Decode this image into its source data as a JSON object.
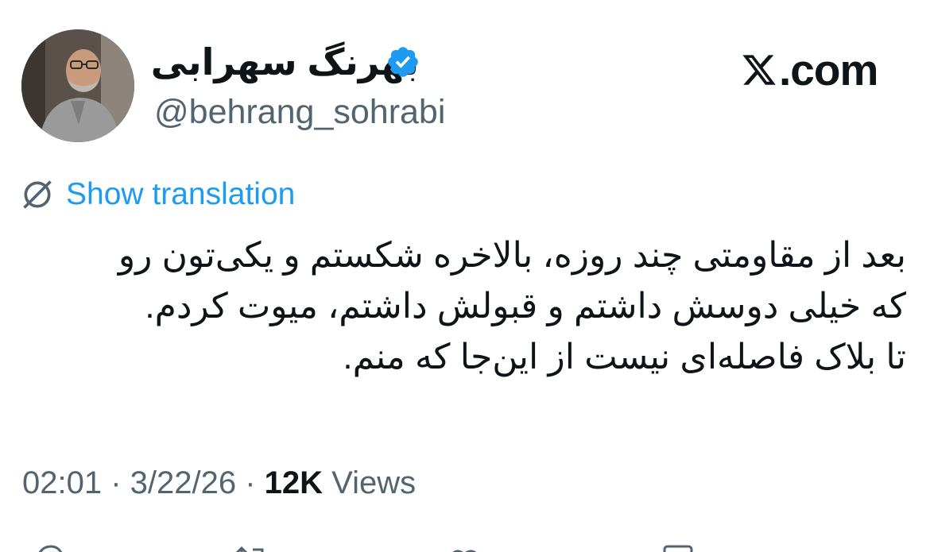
{
  "author": {
    "display_name": "بهرنگ سهرابی",
    "handle": "@behrang_sohrabi",
    "verified_icon": "verified-badge-icon",
    "avatar_icon": "profile-avatar"
  },
  "brand": {
    "logo_icon": "x-logo-icon",
    "text": ".com"
  },
  "translation": {
    "icon": "globe-icon",
    "label": "Show translation"
  },
  "tweet": {
    "lines": [
      "بعد از مقاومتی چند روزه، بالاخره شکستم و یکی‌تون رو",
      "که خیلی دوسش داشتم و قبولش داشتم، میوت کردم.",
      "تا بلاک فاصله‌ای نیست از این‌جا که منم."
    ]
  },
  "meta": {
    "time": "02:01",
    "sep1": " · ",
    "date": "3/22/26",
    "sep2": " · ",
    "views_count": "12K",
    "views_label": " Views"
  },
  "actions": {
    "icons": [
      "reply-icon",
      "repost-icon",
      "like-icon",
      "bookmark-icon",
      "share-icon"
    ]
  },
  "colors": {
    "accent": "#1d9bf0",
    "text": "#0f1419",
    "muted": "#536471",
    "background": "#ffffff"
  }
}
